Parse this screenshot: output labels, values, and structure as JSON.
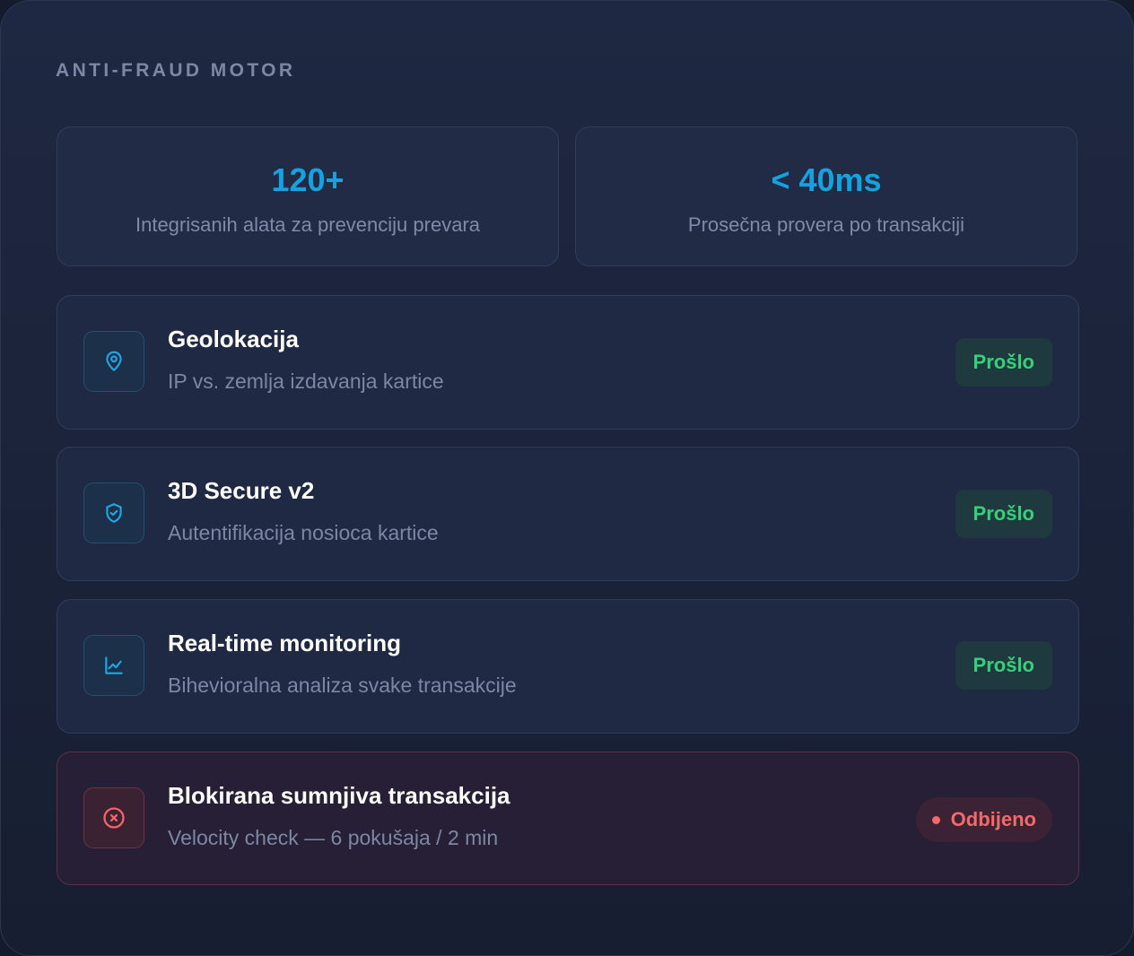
{
  "section_title": "ANTI-FRAUD MOTOR",
  "stats": [
    {
      "value": "120+",
      "label": "Integrisanih alata za prevenciju prevara"
    },
    {
      "value": "< 40ms",
      "label": "Prosečna provera po transakciji"
    }
  ],
  "checks": [
    {
      "icon": "map-pin-icon",
      "title": "Geolokacija",
      "subtitle": "IP vs. zemlja izdavanja kartice",
      "status": "Prošlo"
    },
    {
      "icon": "shield-check-icon",
      "title": "3D Secure v2",
      "subtitle": "Autentifikacija nosioca kartice",
      "status": "Prošlo"
    },
    {
      "icon": "line-chart-icon",
      "title": "Real-time monitoring",
      "subtitle": "Bihevioralna analiza svake transakcije",
      "status": "Prošlo"
    },
    {
      "icon": "x-circle-icon",
      "title": "Blokirana sumnjiva transakcija",
      "subtitle": "Velocity check — 6 pokušaja / 2 min",
      "status": "Odbijeno"
    }
  ],
  "colors": {
    "accent": "#14a3e0",
    "passed": "#34d17a",
    "rejected": "#f26a6a"
  }
}
